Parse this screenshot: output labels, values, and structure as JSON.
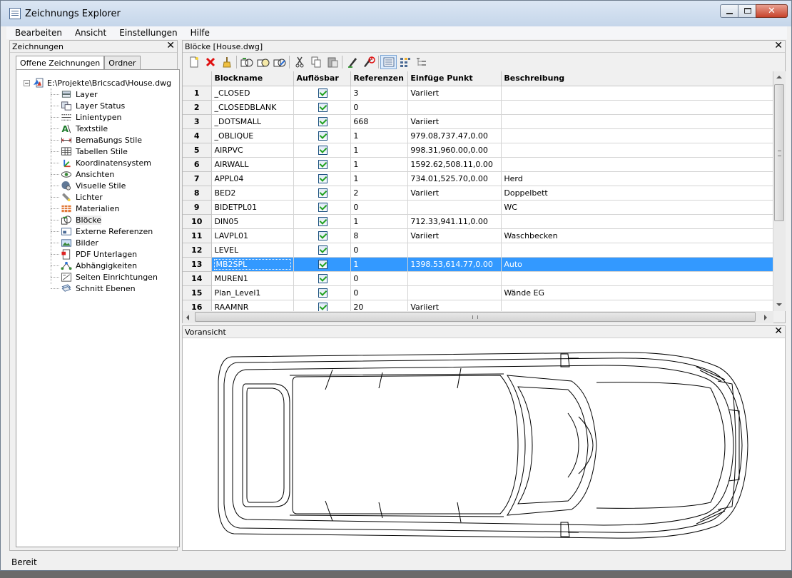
{
  "window": {
    "title": "Zeichnungs Explorer"
  },
  "menu": [
    "Bearbeiten",
    "Ansicht",
    "Einstellungen",
    "Hilfe"
  ],
  "left_panel": {
    "title": "Zeichnungen",
    "tabs": [
      "Offene Zeichnungen",
      "Ordner"
    ],
    "root": "E:\\Projekte\\Bricscad\\House.dwg",
    "items": [
      {
        "label": "Layer",
        "icon": "layer-icon"
      },
      {
        "label": "Layer Status",
        "icon": "layer-status-icon"
      },
      {
        "label": "Linientypen",
        "icon": "linetype-icon"
      },
      {
        "label": "Textstile",
        "icon": "textstyle-icon"
      },
      {
        "label": "Bemaßungs Stile",
        "icon": "dimension-style-icon"
      },
      {
        "label": "Tabellen Stile",
        "icon": "table-style-icon"
      },
      {
        "label": "Koordinatensystem",
        "icon": "ucs-icon"
      },
      {
        "label": "Ansichten",
        "icon": "view-icon"
      },
      {
        "label": "Visuelle Stile",
        "icon": "visual-style-icon"
      },
      {
        "label": "Lichter",
        "icon": "light-icon"
      },
      {
        "label": "Materialien",
        "icon": "material-icon"
      },
      {
        "label": "Blöcke",
        "icon": "block-icon"
      },
      {
        "label": "Externe Referenzen",
        "icon": "xref-icon"
      },
      {
        "label": "Bilder",
        "icon": "image-icon"
      },
      {
        "label": "PDF Unterlagen",
        "icon": "pdf-underlay-icon"
      },
      {
        "label": "Abhängigkeiten",
        "icon": "dependency-icon"
      },
      {
        "label": "Seiten Einrichtungen",
        "icon": "page-setup-icon"
      },
      {
        "label": "Schnitt Ebenen",
        "icon": "section-plane-icon"
      }
    ],
    "selected_index": 11
  },
  "blocks_panel": {
    "title": "Blöcke [House.dwg]",
    "toolbar_icons": [
      "new-icon",
      "delete-icon",
      "purge-icon",
      "insert-block-icon",
      "insert-block-2-icon",
      "insert-block-3-icon",
      "cut-icon",
      "copy-icon",
      "paste-icon",
      "edit-icon",
      "regen-icon",
      "details-view-icon",
      "list-view-icon",
      "tree-view-icon"
    ],
    "columns": [
      "Blockname",
      "Auflösbar",
      "Referenzen",
      "Einfüge Punkt",
      "Beschreibung"
    ],
    "rows": [
      {
        "n": "1",
        "name": "_CLOSED",
        "explodable": true,
        "refs": "3",
        "point": "Variiert",
        "desc": ""
      },
      {
        "n": "2",
        "name": "_CLOSEDBLANK",
        "explodable": true,
        "refs": "0",
        "point": "",
        "desc": ""
      },
      {
        "n": "3",
        "name": "_DOTSMALL",
        "explodable": true,
        "refs": "668",
        "point": "Variiert",
        "desc": ""
      },
      {
        "n": "4",
        "name": "_OBLIQUE",
        "explodable": true,
        "refs": "1",
        "point": "979.08,737.47,0.00",
        "desc": ""
      },
      {
        "n": "5",
        "name": "AIRPVC",
        "explodable": true,
        "refs": "1",
        "point": "998.31,960.00,0.00",
        "desc": ""
      },
      {
        "n": "6",
        "name": "AIRWALL",
        "explodable": true,
        "refs": "1",
        "point": "1592.62,508.11,0.00",
        "desc": ""
      },
      {
        "n": "7",
        "name": "APPL04",
        "explodable": true,
        "refs": "1",
        "point": "734.01,525.70,0.00",
        "desc": "Herd"
      },
      {
        "n": "8",
        "name": "BED2",
        "explodable": true,
        "refs": "2",
        "point": "Variiert",
        "desc": "Doppelbett"
      },
      {
        "n": "9",
        "name": "BIDETPL01",
        "explodable": true,
        "refs": "0",
        "point": "",
        "desc": "WC"
      },
      {
        "n": "10",
        "name": "DIN05",
        "explodable": true,
        "refs": "1",
        "point": "712.33,941.11,0.00",
        "desc": ""
      },
      {
        "n": "11",
        "name": "LAVPL01",
        "explodable": true,
        "refs": "8",
        "point": "Variiert",
        "desc": "Waschbecken"
      },
      {
        "n": "12",
        "name": "LEVEL",
        "explodable": true,
        "refs": "0",
        "point": "",
        "desc": ""
      },
      {
        "n": "13",
        "name": "MB2SPL",
        "explodable": true,
        "refs": "1",
        "point": "1398.53,614.77,0.00",
        "desc": "Auto"
      },
      {
        "n": "14",
        "name": "MUREN1",
        "explodable": true,
        "refs": "0",
        "point": "",
        "desc": ""
      },
      {
        "n": "15",
        "name": "Plan_Level1",
        "explodable": true,
        "refs": "0",
        "point": "",
        "desc": "Wände EG"
      },
      {
        "n": "16",
        "name": "RAAMNR",
        "explodable": true,
        "refs": "20",
        "point": "Variiert",
        "desc": ""
      }
    ],
    "selected_row": 12
  },
  "preview_panel": {
    "title": "Voransicht"
  },
  "status": {
    "text": "Bereit"
  },
  "colors": {
    "selection": "#3399ff",
    "check": "#21a121",
    "delete": "#e01010"
  }
}
